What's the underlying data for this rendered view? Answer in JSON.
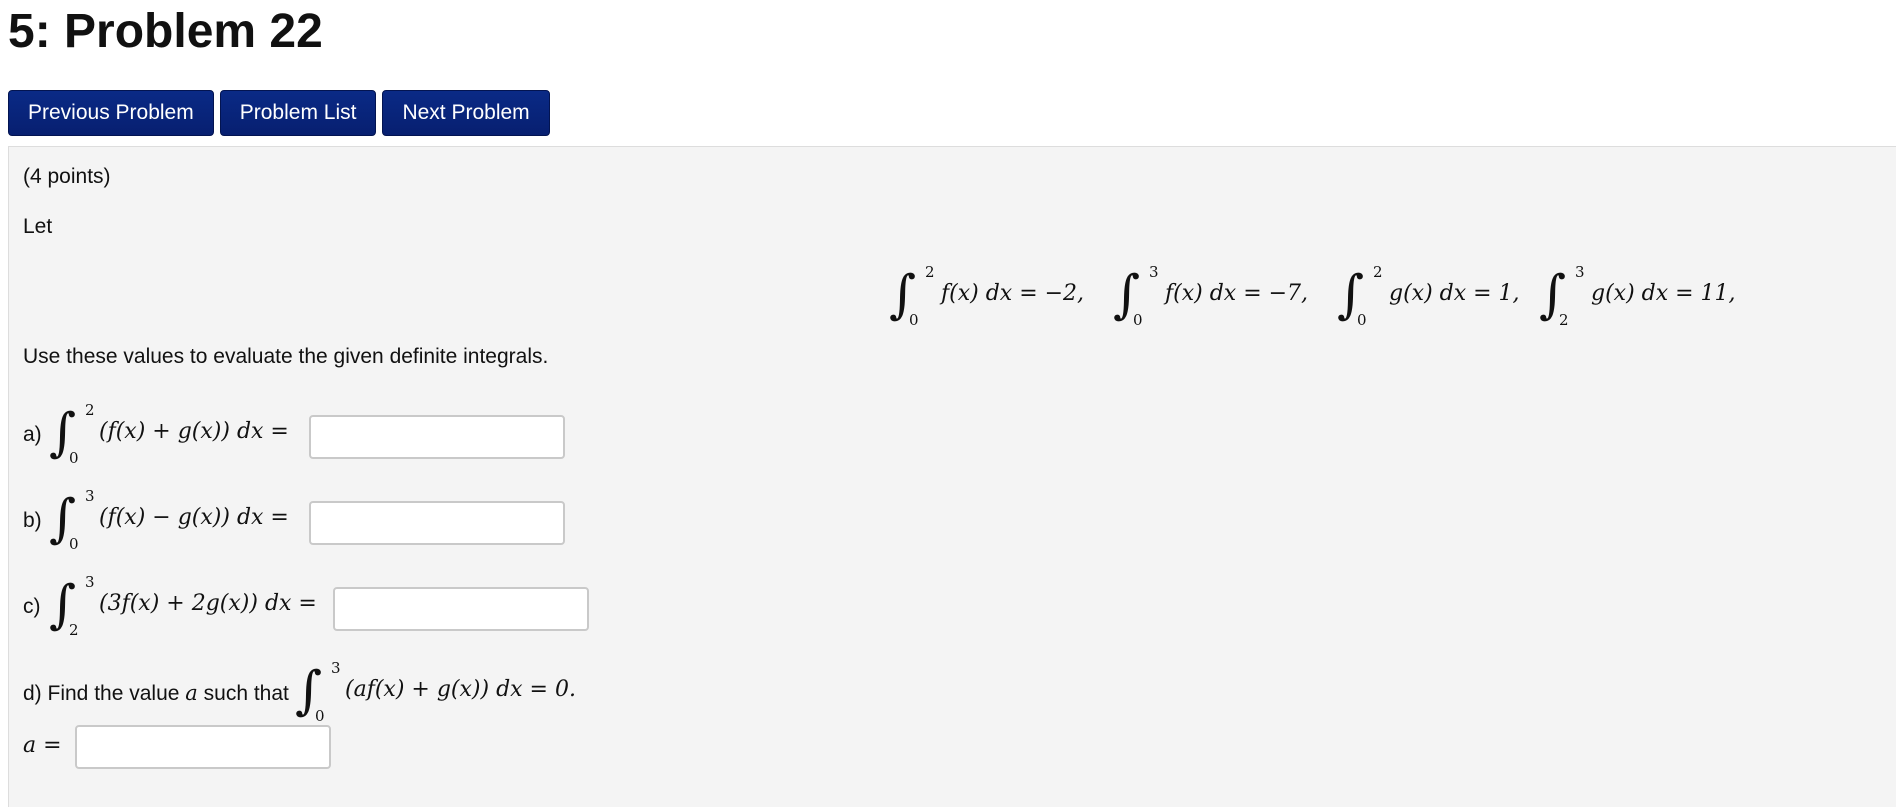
{
  "title": "5: Problem 22",
  "nav": {
    "prev": "Previous Problem",
    "list": "Problem List",
    "next": "Next Problem"
  },
  "problem": {
    "points": "(4 points)",
    "let": "Let",
    "given": [
      {
        "upper": "2",
        "lower": "0",
        "expr": "f(x) dx = −2,"
      },
      {
        "upper": "3",
        "lower": "0",
        "expr": "f(x) dx = −7,"
      },
      {
        "upper": "2",
        "lower": "0",
        "expr": "g(x) dx = 1,"
      },
      {
        "upper": "3",
        "lower": "2",
        "expr": "g(x) dx = 11,"
      }
    ],
    "instruction": "Use these values to evaluate the given definite integrals.",
    "parts": [
      {
        "label": "a)",
        "upper": "2",
        "lower": "0",
        "expr": "(f(x) + g(x)) dx ="
      },
      {
        "label": "b)",
        "upper": "3",
        "lower": "0",
        "expr": "(f(x) − g(x)) dx ="
      },
      {
        "label": "c)",
        "upper": "3",
        "lower": "2",
        "expr": "(3f(x) + 2g(x)) dx ="
      }
    ],
    "part_d": {
      "text": "d) Find the value",
      "var": "a",
      "text2": "such that",
      "upper": "3",
      "lower": "0",
      "expr": "(af(x) + g(x)) dx = 0.",
      "answer_label": "a ="
    }
  },
  "answers": {
    "a": "",
    "b": "",
    "c": "",
    "d": ""
  }
}
